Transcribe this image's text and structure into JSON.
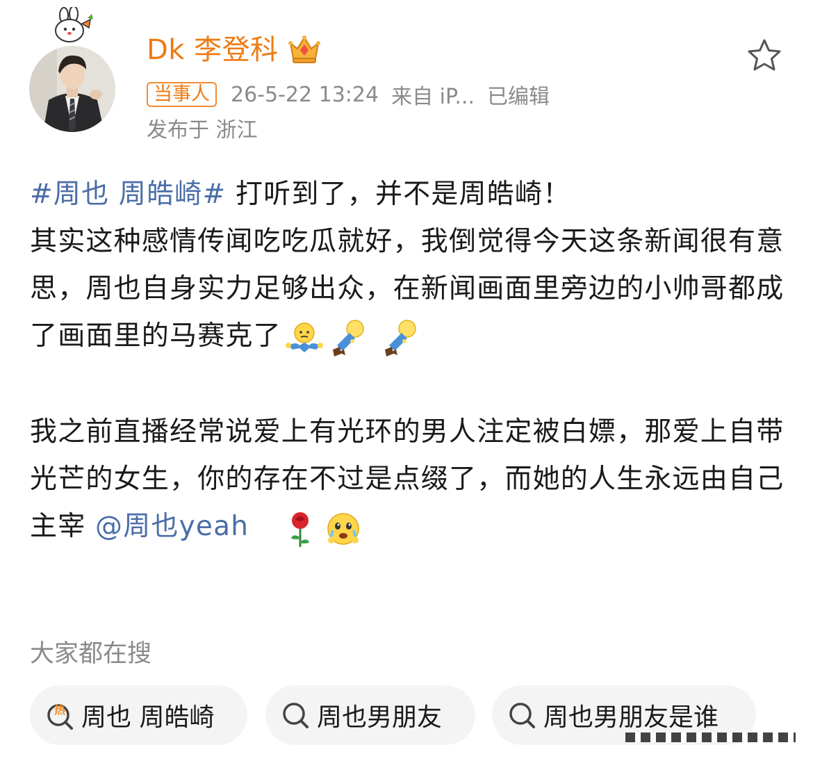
{
  "profile": {
    "username": "Dk 李登科",
    "badge": "当事人",
    "timestamp": "26-5-22 13:24",
    "source": "来自 iP...",
    "edited": "已编辑",
    "location": "发布于 浙江"
  },
  "post": {
    "hashtag": "#周也 周皓崎#",
    "line1_rest": " 打听到了，并不是周皓崎！",
    "para1": "其实这种感情传闻吃吃瓜就好，我倒觉得今天这条新闻很有意思，周也自身实力足够出众，在新闻画面里旁边的小帅哥都成了画面里的马赛克了",
    "para2": "我之前直播经常说爱上有光环的男人注定被白嫖，那爱上自带光芒的女生，你的存在不过是点缀了，而她的人生永远由自己主宰",
    "mention": "@周也yeah",
    "emoji_1": "shrug-emoji",
    "emoji_2": "lying-flat-emoji",
    "emoji_3": "lying-flat-emoji",
    "emoji_4": "rose-emoji",
    "emoji_5": "touched-crying-emoji"
  },
  "search": {
    "title": "大家都在搜",
    "chips": [
      {
        "label": "周也 周皓崎",
        "icon": "hot-search-icon"
      },
      {
        "label": "周也男朋友",
        "icon": "search-icon"
      },
      {
        "label": "周也男朋友是谁",
        "icon": "search-icon"
      }
    ]
  },
  "colors": {
    "username": "#ef7a12",
    "link": "#4a6da7",
    "meta": "#8a8a8a"
  }
}
